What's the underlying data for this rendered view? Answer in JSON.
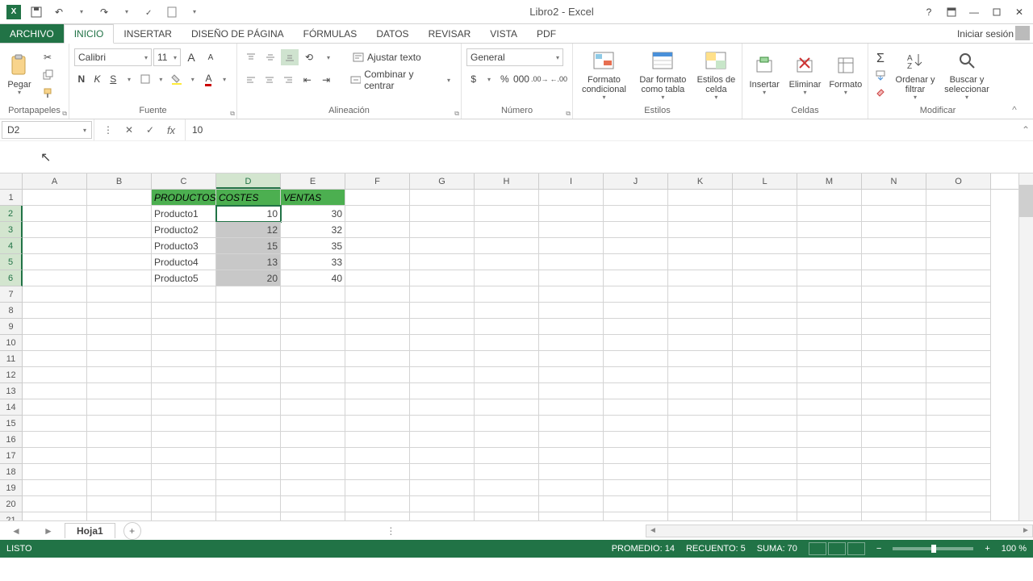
{
  "title": "Libro2 - Excel",
  "qat": {
    "undo": "↶",
    "redo": "↷"
  },
  "tabs": {
    "file": "ARCHIVO",
    "items": [
      "INICIO",
      "INSERTAR",
      "DISEÑO DE PÁGINA",
      "FÓRMULAS",
      "DATOS",
      "REVISAR",
      "VISTA",
      "PDF"
    ],
    "active": 0,
    "signin": "Iniciar sesión"
  },
  "ribbon": {
    "clipboard": {
      "paste": "Pegar",
      "label": "Portapapeles"
    },
    "font": {
      "name": "Calibri",
      "size": "11",
      "bold": "N",
      "italic": "K",
      "underline": "S",
      "label": "Fuente"
    },
    "align": {
      "wrap": "Ajustar texto",
      "merge": "Combinar y centrar",
      "label": "Alineación"
    },
    "number": {
      "format": "General",
      "label": "Número"
    },
    "styles": {
      "cond": "Formato condicional",
      "table": "Dar formato como tabla",
      "cell": "Estilos de celda",
      "label": "Estilos"
    },
    "cells": {
      "insert": "Insertar",
      "delete": "Eliminar",
      "format": "Formato",
      "label": "Celdas"
    },
    "editing": {
      "sort": "Ordenar y filtrar",
      "find": "Buscar y seleccionar",
      "label": "Modificar"
    }
  },
  "formula_bar": {
    "name_box": "D2",
    "value": "10"
  },
  "columns": [
    "A",
    "B",
    "C",
    "D",
    "E",
    "F",
    "G",
    "H",
    "I",
    "J",
    "K",
    "L",
    "M",
    "N",
    "O"
  ],
  "selected_col": "D",
  "selected_rows": [
    2,
    3,
    4,
    5,
    6
  ],
  "sheet": {
    "headers": {
      "c": "PRODUCTOS",
      "d": "COSTES",
      "e": "VENTAS"
    },
    "rows": [
      {
        "c": "Producto1",
        "d": "10",
        "e": "30"
      },
      {
        "c": "Producto2",
        "d": "12",
        "e": "32"
      },
      {
        "c": "Producto3",
        "d": "15",
        "e": "35"
      },
      {
        "c": "Producto4",
        "d": "13",
        "e": "33"
      },
      {
        "c": "Producto5",
        "d": "20",
        "e": "40"
      }
    ]
  },
  "sheet_tab": "Hoja1",
  "status": {
    "ready": "LISTO",
    "avg_label": "PROMEDIO:",
    "avg": "14",
    "count_label": "RECUENTO:",
    "count": "5",
    "sum_label": "SUMA:",
    "sum": "70",
    "zoom": "100 %"
  },
  "chart_data": {
    "type": "table",
    "title": "",
    "columns": [
      "PRODUCTOS",
      "COSTES",
      "VENTAS"
    ],
    "rows": [
      [
        "Producto1",
        10,
        30
      ],
      [
        "Producto2",
        12,
        32
      ],
      [
        "Producto3",
        15,
        35
      ],
      [
        "Producto4",
        13,
        33
      ],
      [
        "Producto5",
        20,
        40
      ]
    ]
  }
}
